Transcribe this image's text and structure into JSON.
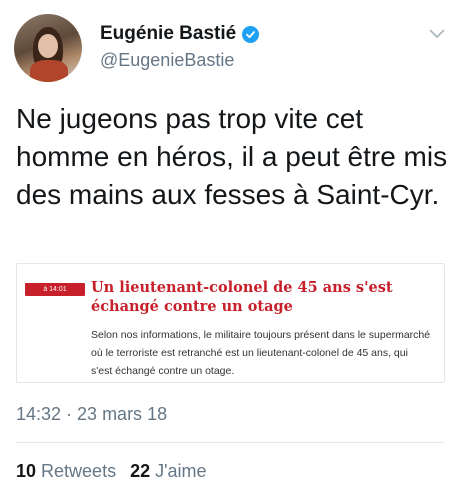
{
  "user": {
    "display_name": "Eugénie Bastié",
    "handle": "@EugenieBastie",
    "verified": true
  },
  "tweet": {
    "text": "Ne jugeons pas trop vite cet homme en héros, il a peut être mis des mains aux fesses à Saint-Cyr."
  },
  "card": {
    "time_badge": "à 14:01",
    "headline": "Un lieutenant-colonel de 45 ans s'est échangé contre un otage",
    "body": "Selon nos informations, le militaire toujours présent dans le supermarché où le terroriste est retranché est un lieutenant-colonel de 45 ans, qui s'est échangé contre un otage.",
    "accent_color": "#c8202a"
  },
  "meta": {
    "timestamp": "14:32 · 23 mars 18"
  },
  "stats": {
    "retweets_count": "10",
    "retweets_label": "Retweets",
    "likes_count": "22",
    "likes_label": "J'aime"
  },
  "icons": {
    "verified": "verified-badge-icon",
    "menu": "chevron-down-icon"
  },
  "colors": {
    "verified_blue": "#1da1f2",
    "secondary_text": "#657786"
  }
}
